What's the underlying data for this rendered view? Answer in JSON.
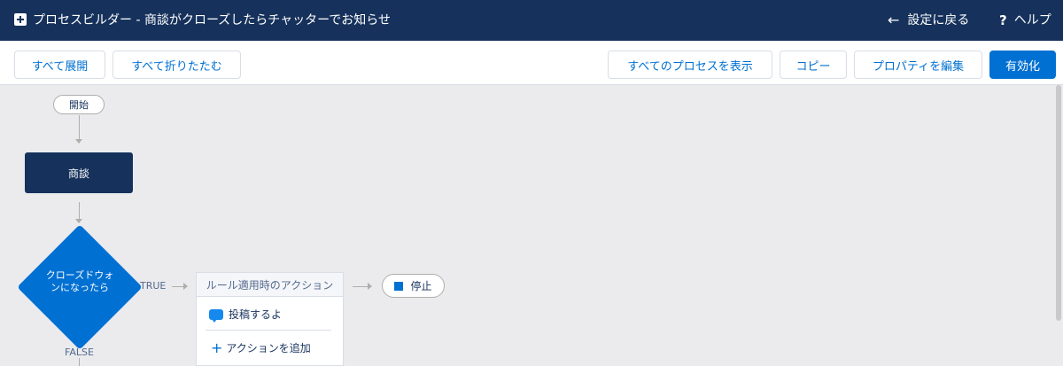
{
  "header": {
    "title": "プロセスビルダー - 商談がクローズしたらチャッターでお知らせ",
    "back_label": "設定に戻る",
    "help_label": "ヘルプ"
  },
  "toolbar": {
    "expand_all": "すべて展開",
    "collapse_all": "すべて折りたたむ",
    "view_all": "すべてのプロセスを表示",
    "copy": "コピー",
    "edit_properties": "プロパティを編集",
    "activate": "有効化"
  },
  "canvas": {
    "start_label": "開始",
    "object_label": "商談",
    "criteria_label_line1": "クローズドウォ",
    "criteria_label_line2": "ンになったら",
    "true_label": "TRUE",
    "false_label": "FALSE",
    "action_group_header": "ルール適用時のアクション",
    "action_item": "投稿するよ",
    "add_action": "アクションを追加",
    "stop_label": "停止"
  },
  "colors": {
    "header_bg": "#16325c",
    "brand": "#0070d2",
    "canvas_bg": "#ebebee"
  }
}
